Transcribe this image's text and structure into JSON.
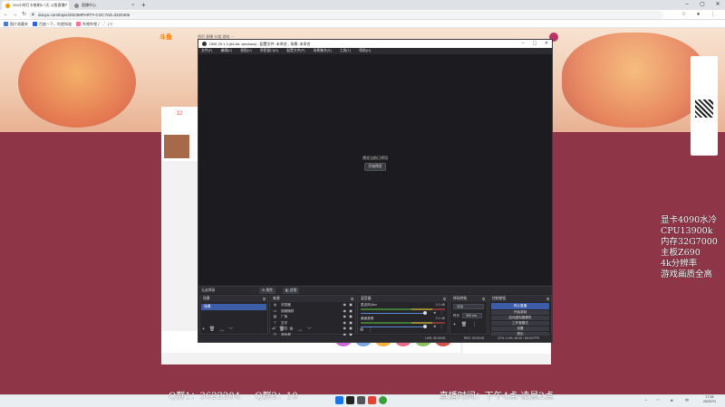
{
  "browser": {
    "tabs": [
      {
        "label": "294小时打卡夜刷5-7天 斗鱼直播"
      },
      {
        "label": "直播中心"
      }
    ],
    "url": "douyu.com/topic/2023MPARTY-COC?rid=3220405",
    "bookmarks": [
      "图片收藏夹",
      "百度一下，你就知道",
      "哔哩哔哩 (゜-゜)つ"
    ]
  },
  "site": {
    "logo": "斗鱼",
    "nav": "首页 直播 分类 游戏 ···",
    "follow_count": "12"
  },
  "obs": {
    "title": "OBS 29.1.3 (64-bit, windows) - 配置文件: 未命名 - 场景: 未命名",
    "menu": [
      "文件(F)",
      "编辑(E)",
      "视图(V)",
      "停靠窗口(D)",
      "配置文件(P)",
      "场景集合(S)",
      "工具(T)",
      "帮助(H)"
    ],
    "preview_message": "预览当前已停用",
    "preview_button": "开始预览",
    "context": {
      "label": "无选择源",
      "props": "属性",
      "filters": "滤镜"
    },
    "docks": {
      "scenes": {
        "title": "场景",
        "items": [
          "场景"
        ]
      },
      "sources": {
        "title": "来源",
        "items": [
          {
            "name": "浏览器",
            "icon": "globe-icon"
          },
          {
            "name": "视频捕获",
            "icon": "camera-icon"
          },
          {
            "name": "厂商",
            "icon": "image-icon"
          },
          {
            "name": "文字",
            "icon": "text-icon"
          },
          {
            "name": "公告",
            "icon": "text-icon"
          },
          {
            "name": "游戏源",
            "icon": "gamepad-icon"
          },
          {
            "name": "显示器采集",
            "icon": "monitor-icon"
          }
        ]
      },
      "mixer": {
        "title": "混音器",
        "channels": [
          {
            "name": "麦克风/Aux",
            "db": "0.0 dB"
          },
          {
            "name": "桌面音频",
            "db": "0.0 dB"
          }
        ]
      },
      "transitions": {
        "title": "转场特效",
        "type": "淡出",
        "duration_label": "时长",
        "duration": "300 ms"
      },
      "controls": {
        "title": "控制按钮",
        "buttons": [
          "停止直播",
          "开始录制",
          "启动虚拟摄像机",
          "工作室模式",
          "设置",
          "退出"
        ]
      }
    },
    "status": {
      "live": "LIVE: 00:00:00",
      "rec": "REC: 00:00:00",
      "cpu": "CPU: 0.4%, 60.00 / 60.00 FPS"
    }
  },
  "overlay_lines": [
    "显卡4090水冷",
    "CPU13900k",
    "内存32G7000",
    "主板Z690",
    "4k分辨率",
    "游戏画质全高"
  ],
  "ticker": [
    "Q群1：3622204",
    "Q群2：10",
    "直播时间：下午4点-凌晨2点"
  ],
  "taskbar": {
    "time": "17:28",
    "date": "2023/7/1"
  }
}
